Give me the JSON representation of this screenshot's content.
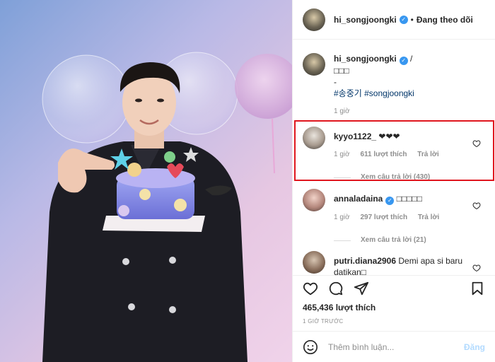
{
  "post": {
    "username": "hi_songjoongki",
    "follow_label": "Đang theo dõi",
    "dot": "•",
    "caption_suffix": "/",
    "caption_line2": "□□□",
    "caption_line3": "-",
    "hashtags": "#송중기 #songjoongki",
    "caption_time": "1 giờ"
  },
  "comments": [
    {
      "username": "kyyo1122_",
      "text": "❤❤❤",
      "time": "1 giờ",
      "likes": "611 lượt thích",
      "reply": "Trả lời",
      "view_replies": "Xem câu trả lời (430)"
    },
    {
      "username": "annaladaina",
      "text": "□□□□□",
      "time": "1 giờ",
      "likes": "297 lượt thích",
      "reply": "Trả lời",
      "view_replies": "Xem câu trả lời (21)"
    },
    {
      "username": "putri.diana2906",
      "text": "Demi apa si baru datikan□"
    }
  ],
  "actions": {
    "likes": "465,436 lượt thích",
    "ago": "1 GIỜ TRƯỚC"
  },
  "add_comment": {
    "placeholder": "Thêm bình luận...",
    "post_label": "Đăng"
  },
  "icons": [
    "verified-badge-icon",
    "heart-icon",
    "comment-icon",
    "share-icon",
    "bookmark-icon",
    "emoji-icon"
  ],
  "colors": {
    "link": "#003569",
    "verified": "#3897f0",
    "highlight": "#e0161e",
    "post_button": "#b3dbff"
  }
}
